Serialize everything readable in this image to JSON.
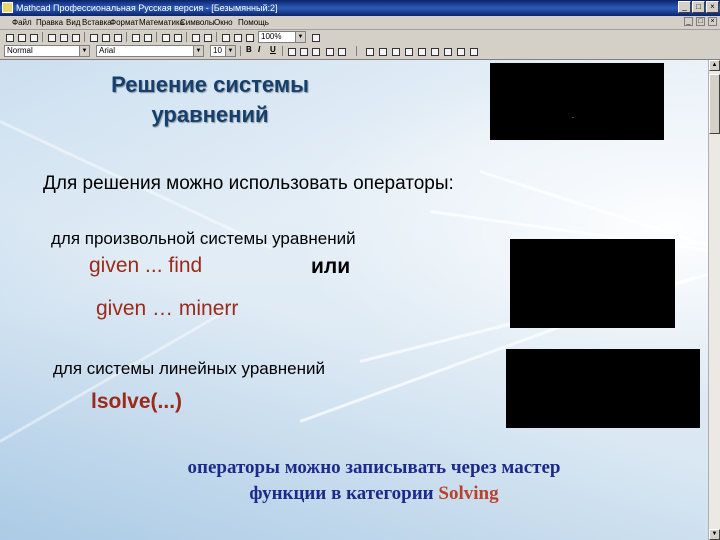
{
  "window": {
    "title": "Mathcad Профессиональная Русская версия - [Безымянный:2]",
    "buttons": [
      "_",
      "□",
      "×"
    ]
  },
  "menu": {
    "items": [
      "Файл",
      "Правка",
      "Вид",
      "Вставка",
      "Формат",
      "Математика",
      "Символы",
      "Окно",
      "Помощь"
    ],
    "mdi_buttons": [
      "_",
      "□",
      "×"
    ]
  },
  "toolbar2": {
    "style_value": "Normal",
    "font_value": "Arial",
    "size_value": "10",
    "zoom_value": "100%",
    "bold": "B",
    "italic": "I",
    "underline": "U"
  },
  "document": {
    "heading_line1": "Решение системы",
    "heading_line2": "уравнений",
    "intro": "Для решения можно использовать операторы:",
    "sub1": "для произвольной системы уравнений",
    "op1": "given ... find",
    "or": "или",
    "op2": "given … minerr",
    "sub2": "для системы линейных уравнений",
    "op3": "lsolve(...)",
    "note_line1": "операторы можно записывать через мастер",
    "note_line2_prefix": "функции в категории ",
    "note_highlight": "Solving"
  },
  "colors": {
    "heading": "#15406e",
    "operator": "#9c2a1a",
    "note": "#1e2a8a",
    "note_highlight": "#b8422a"
  }
}
